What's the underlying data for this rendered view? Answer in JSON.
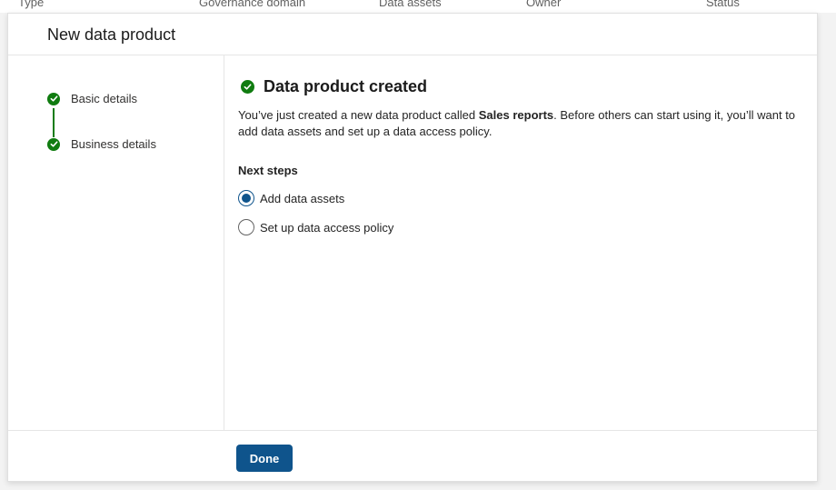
{
  "background_table": {
    "columns": [
      "Type",
      "Governance domain",
      "Data assets",
      "Owner",
      "Status"
    ]
  },
  "dialog": {
    "title": "New data product",
    "steps": [
      {
        "label": "Basic details",
        "status": "complete"
      },
      {
        "label": "Business details",
        "status": "complete"
      }
    ],
    "success_title": "Data product created",
    "description": {
      "before": "You’ve just created a new data product called ",
      "product_name": "Sales reports",
      "after": ". Before others can start using it, you’ll want to add data assets and set up a data access policy."
    },
    "next_steps": {
      "label": "Next steps",
      "options": [
        {
          "label": "Add data assets",
          "selected": true
        },
        {
          "label": "Set up data access policy",
          "selected": false
        }
      ]
    },
    "done_label": "Done"
  },
  "colors": {
    "success_green": "#107c10",
    "brand_blue": "#0f548c"
  }
}
